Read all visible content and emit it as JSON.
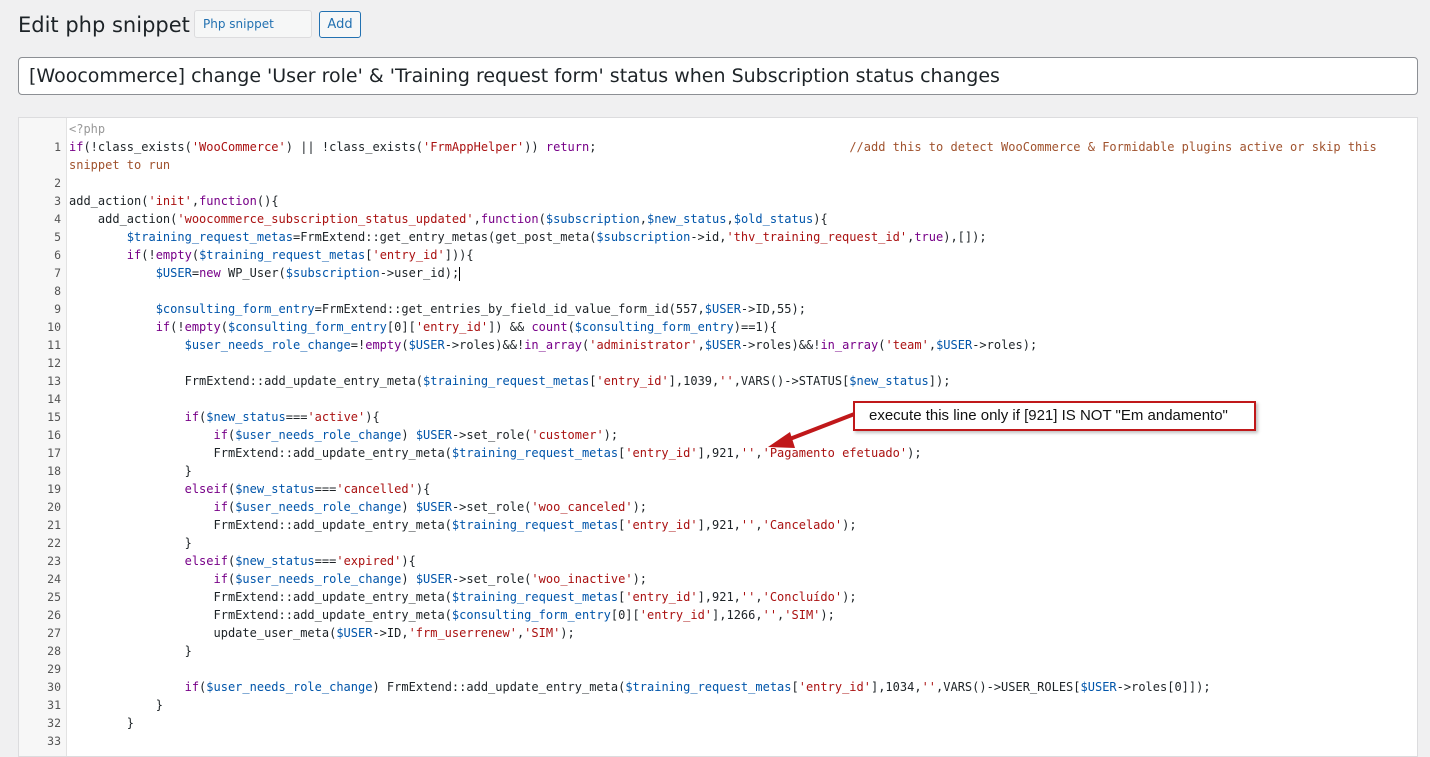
{
  "header": {
    "title": "Edit php snippet",
    "type_label": "Php snippet",
    "add_label": "Add"
  },
  "snippet_title": "[Woocommerce] change 'User role' & 'Training request form' status when Subscription status changes",
  "editor": {
    "opening_tag": "<?php",
    "lines": [
      {
        "n": "1",
        "text": "if(!class_exists('WooCommerce') || !class_exists('FrmAppHelper')) return;                                   //add this to detect WooCommerce & Formidable plugins active or skip this snippet to run"
      },
      {
        "n": "2",
        "text": ""
      },
      {
        "n": "3",
        "text": "add_action('init',function(){"
      },
      {
        "n": "4",
        "text": "    add_action('woocommerce_subscription_status_updated',function($subscription,$new_status,$old_status){"
      },
      {
        "n": "5",
        "text": "        $training_request_metas=FrmExtend::get_entry_metas(get_post_meta($subscription->id,'thv_training_request_id',true),[]);"
      },
      {
        "n": "6",
        "text": "        if(!empty($training_request_metas['entry_id'])){"
      },
      {
        "n": "7",
        "text": "            $USER=new WP_User($subscription->user_id);"
      },
      {
        "n": "8",
        "text": ""
      },
      {
        "n": "9",
        "text": "            $consulting_form_entry=FrmExtend::get_entries_by_field_id_value_form_id(557,$USER->ID,55);"
      },
      {
        "n": "10",
        "text": "            if(!empty($consulting_form_entry[0]['entry_id']) && count($consulting_form_entry)==1){"
      },
      {
        "n": "11",
        "text": "                $user_needs_role_change=!empty($USER->roles)&&!in_array('administrator',$USER->roles)&&!in_array('team',$USER->roles);"
      },
      {
        "n": "12",
        "text": ""
      },
      {
        "n": "13",
        "text": "                FrmExtend::add_update_entry_meta($training_request_metas['entry_id'],1039,'',VARS()->STATUS[$new_status]);"
      },
      {
        "n": "14",
        "text": ""
      },
      {
        "n": "15",
        "text": "                if($new_status==='active'){"
      },
      {
        "n": "16",
        "text": "                    if($user_needs_role_change) $USER->set_role('customer');"
      },
      {
        "n": "17",
        "text": "                    FrmExtend::add_update_entry_meta($training_request_metas['entry_id'],921,'','Pagamento efetuado');"
      },
      {
        "n": "18",
        "text": "                }"
      },
      {
        "n": "19",
        "text": "                elseif($new_status==='cancelled'){"
      },
      {
        "n": "20",
        "text": "                    if($user_needs_role_change) $USER->set_role('woo_canceled');"
      },
      {
        "n": "21",
        "text": "                    FrmExtend::add_update_entry_meta($training_request_metas['entry_id'],921,'','Cancelado');"
      },
      {
        "n": "22",
        "text": "                }"
      },
      {
        "n": "23",
        "text": "                elseif($new_status==='expired'){"
      },
      {
        "n": "24",
        "text": "                    if($user_needs_role_change) $USER->set_role('woo_inactive');"
      },
      {
        "n": "25",
        "text": "                    FrmExtend::add_update_entry_meta($training_request_metas['entry_id'],921,'','Concluído');"
      },
      {
        "n": "26",
        "text": "                    FrmExtend::add_update_entry_meta($consulting_form_entry[0]['entry_id'],1266,'','SIM');"
      },
      {
        "n": "27",
        "text": "                    update_user_meta($USER->ID,'frm_userrenew','SIM');"
      },
      {
        "n": "28",
        "text": "                }"
      },
      {
        "n": "29",
        "text": ""
      },
      {
        "n": "30",
        "text": "                if($user_needs_role_change) FrmExtend::add_update_entry_meta($training_request_metas['entry_id'],1034,'',VARS()->USER_ROLES[$USER->roles[0]]);"
      },
      {
        "n": "31",
        "text": "            }"
      },
      {
        "n": "32",
        "text": "        }"
      },
      {
        "n": "33",
        "text": ""
      }
    ]
  },
  "annotation": {
    "text": "execute this line only if [921] IS NOT \"Em andamento\"",
    "color": "#c0181a"
  },
  "colors": {
    "background": "#f0f0f1",
    "accent": "#2271b1",
    "keyword": "#770088",
    "string": "#aa1111",
    "variable": "#0055aa",
    "comment": "#a0522d"
  }
}
